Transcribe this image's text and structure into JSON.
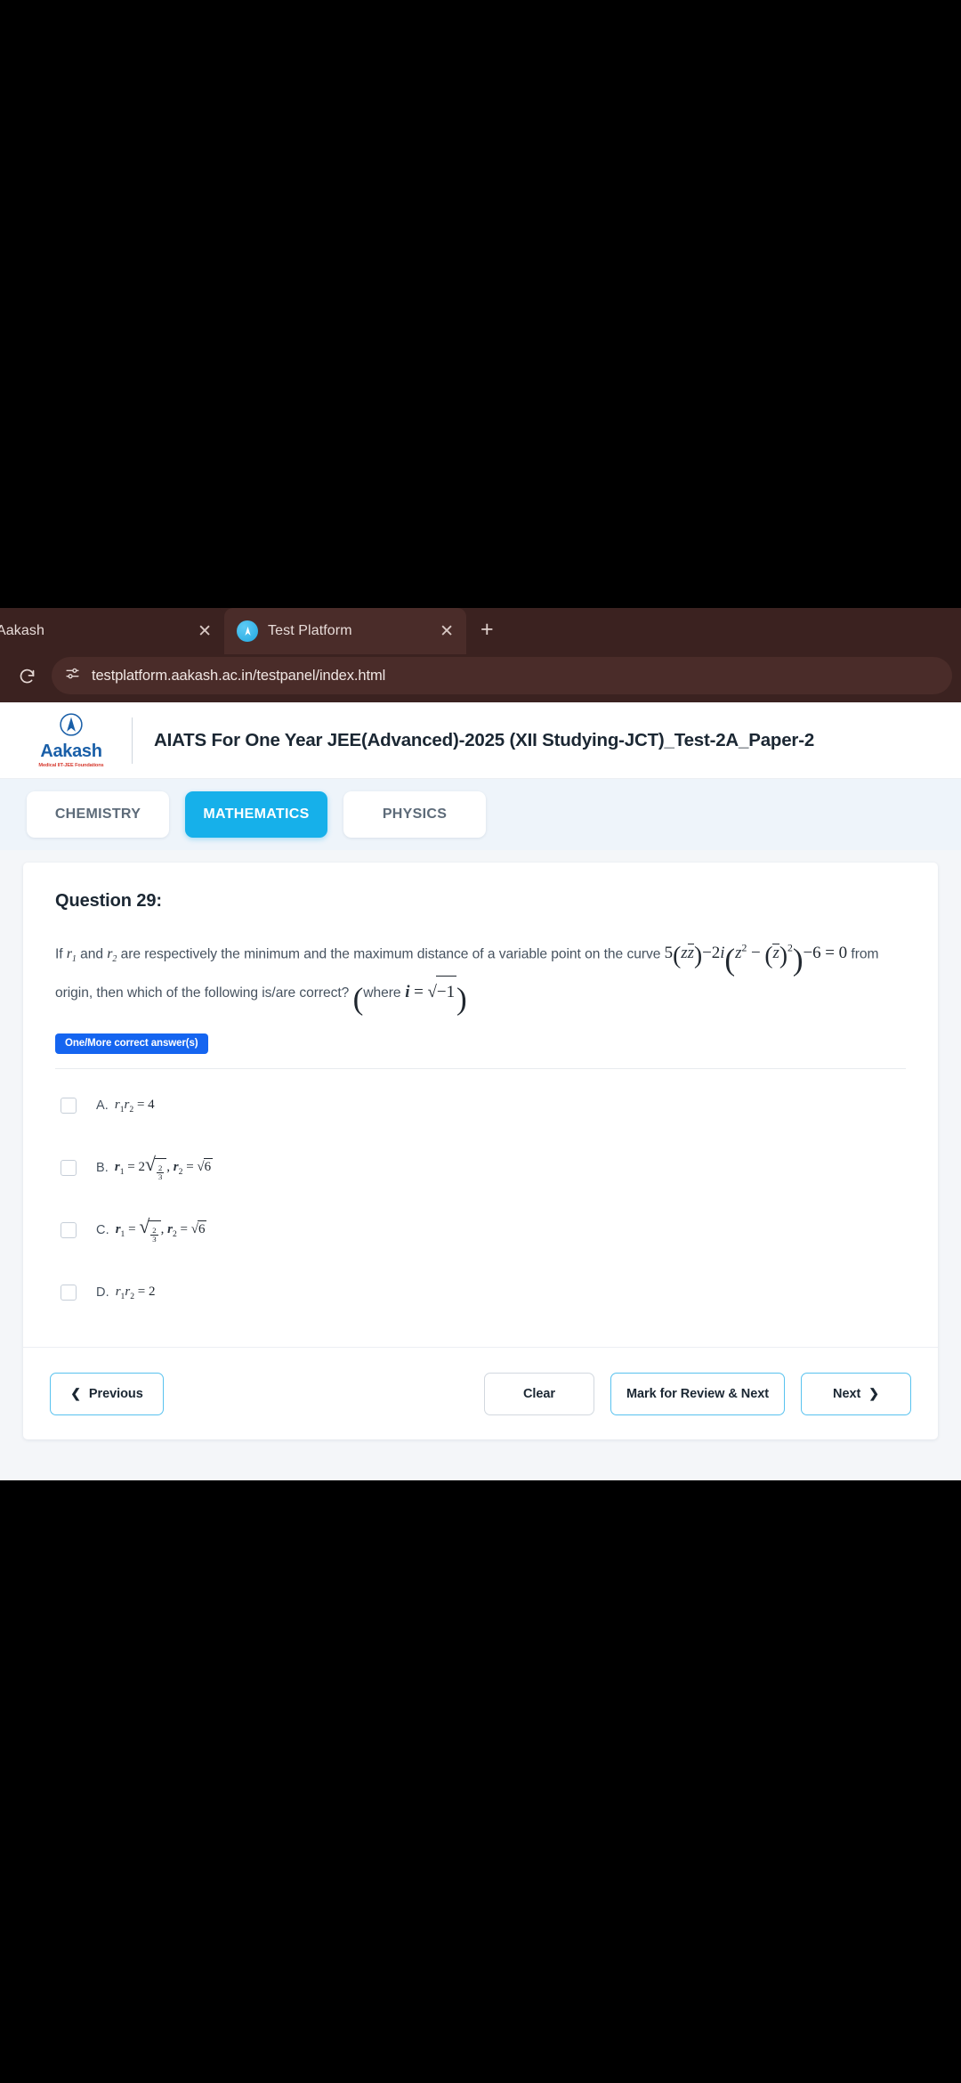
{
  "browser": {
    "tabs": [
      {
        "title": "Aakash",
        "active": false,
        "favicon": "none",
        "close_icon": "close-icon"
      },
      {
        "title": "Test Platform",
        "active": true,
        "favicon": "aakash-favicon",
        "close_icon": "close-icon"
      }
    ],
    "new_tab_label": "+",
    "reload_icon": "reload-icon",
    "site_settings_icon": "tune-icon",
    "url": "testplatform.aakash.ac.in/testpanel/index.html"
  },
  "header": {
    "brand_name": "Aakash",
    "brand_subtitle": "Medical IIT-JEE Foundations",
    "brand_logo_icon": "aakash-logo-icon",
    "exam_title": "AIATS For One Year JEE(Advanced)-2025 (XII Studying-JCT)_Test-2A_Paper-2"
  },
  "subject_tabs": [
    {
      "label": "CHEMISTRY",
      "active": false
    },
    {
      "label": "MATHEMATICS",
      "active": true
    },
    {
      "label": "PHYSICS",
      "active": false
    }
  ],
  "question": {
    "number_label": "Question 29:",
    "text_part1": "If",
    "var1": "r",
    "var1_sub": "1",
    "text_and": "and",
    "var2": "r",
    "var2_sub": "2",
    "text_part2": "are respectively the minimum and the maximum distance of a variable point on the curve",
    "equation": "5(z z̄) − 2i(z² − (z̄)²) − 6 = 0",
    "text_part3": "from origin,",
    "text_part4": "then which of the following is/are correct?",
    "note": "(where i = √−1)",
    "badge": "One/More correct answer(s)"
  },
  "options": [
    {
      "letter": "A.",
      "math": "r₁r₂ = 4",
      "checked": false
    },
    {
      "letter": "B.",
      "math": "r₁ = 2√(2/3), r₂ = √6",
      "checked": false
    },
    {
      "letter": "C.",
      "math": "r₁ = √(2/3), r₂ = √6",
      "checked": false
    },
    {
      "letter": "D.",
      "math": "r₁r₂ = 2",
      "checked": false
    }
  ],
  "footer": {
    "previous_label": "Previous",
    "previous_icon": "chevron-left-icon",
    "clear_label": "Clear",
    "review_label": "Mark for Review & Next",
    "next_label": "Next",
    "next_icon": "chevron-right-icon"
  },
  "colors": {
    "accent_blue": "#16b0ea",
    "badge_blue": "#1565f0",
    "brand_blue": "#1a5fa8",
    "brand_red": "#d63a2f",
    "browser_chrome": "#3b2220",
    "page_bg": "#f4f6f9"
  }
}
